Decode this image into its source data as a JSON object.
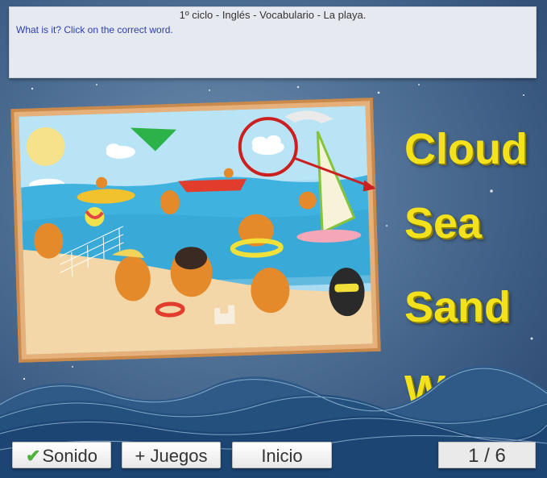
{
  "header": {
    "title": "1º ciclo - Inglés - Vocabulario - La playa.",
    "instruction": "What is it? Click on the correct word."
  },
  "answers": [
    {
      "label": "Cloud"
    },
    {
      "label": "Sea"
    },
    {
      "label": "Sand"
    },
    {
      "label": "Wave"
    }
  ],
  "buttons": {
    "sound": "Sonido",
    "more_games": "+ Juegos",
    "home": "Inicio"
  },
  "progress": {
    "current": 1,
    "total": 6,
    "label": "1 / 6"
  },
  "colors": {
    "word": "#f3e21b",
    "instruction": "#2b3fa8",
    "marker": "#cc1f1f",
    "frame": "#c98a4b"
  },
  "icons": {
    "sound_check": "checkmark-icon"
  }
}
